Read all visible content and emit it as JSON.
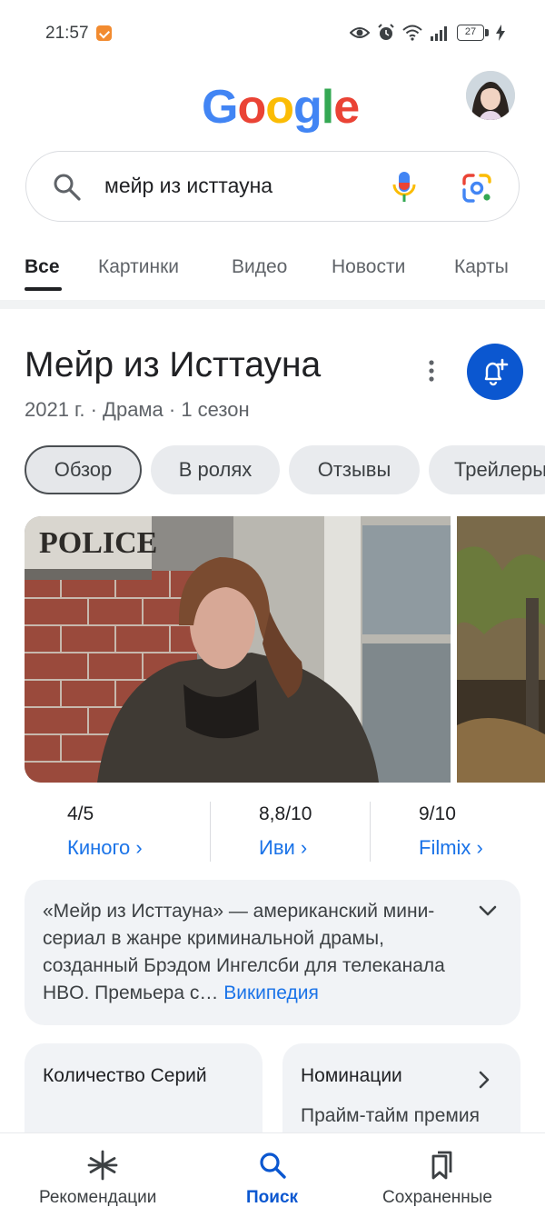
{
  "status_bar": {
    "time": "21:57",
    "battery": "27"
  },
  "header": {
    "logo": [
      "G",
      "o",
      "o",
      "g",
      "l",
      "e"
    ]
  },
  "search": {
    "query": "мейр из исттауна"
  },
  "tabs": [
    {
      "label": "Все",
      "active": true
    },
    {
      "label": "Картинки",
      "active": false
    },
    {
      "label": "Видео",
      "active": false
    },
    {
      "label": "Новости",
      "active": false
    },
    {
      "label": "Карты",
      "active": false
    }
  ],
  "knowledge_panel": {
    "title": "Мейр из Исттауна",
    "subtitle": "2021 г. · Драма · 1 сезон",
    "chips": [
      {
        "label": "Обзор",
        "selected": true
      },
      {
        "label": "В ролях",
        "selected": false
      },
      {
        "label": "Отзывы",
        "selected": false
      },
      {
        "label": "Трейлеры",
        "selected": false
      }
    ],
    "image_sign": "POLICE",
    "ratings": [
      {
        "score": "4/5",
        "source": "Киного ›"
      },
      {
        "score": "8,8/10",
        "source": "Иви ›"
      },
      {
        "score": "9/10",
        "source": "Filmix ›"
      }
    ],
    "description": {
      "text": "«Мейр из Исттауна» — американский мини-сериал в жанре криминальной драмы, созданный Брэдом Ингелсби для телеканала HBO. Премьера с…",
      "link": "Википедия"
    },
    "info_cards": [
      {
        "title": "Количество Серий",
        "body": ""
      },
      {
        "title": "Номинации",
        "body": "Прайм-тайм премия"
      }
    ]
  },
  "bottom_nav": [
    {
      "label": "Рекомендации",
      "icon": "asterisk-icon",
      "active": false
    },
    {
      "label": "Поиск",
      "icon": "search-icon",
      "active": true
    },
    {
      "label": "Сохраненные",
      "icon": "bookmarks-icon",
      "active": false
    }
  ],
  "colors": {
    "accent_blue": "#0b57d0",
    "link_blue": "#1a73e8",
    "card_bg": "#f1f3f6"
  }
}
